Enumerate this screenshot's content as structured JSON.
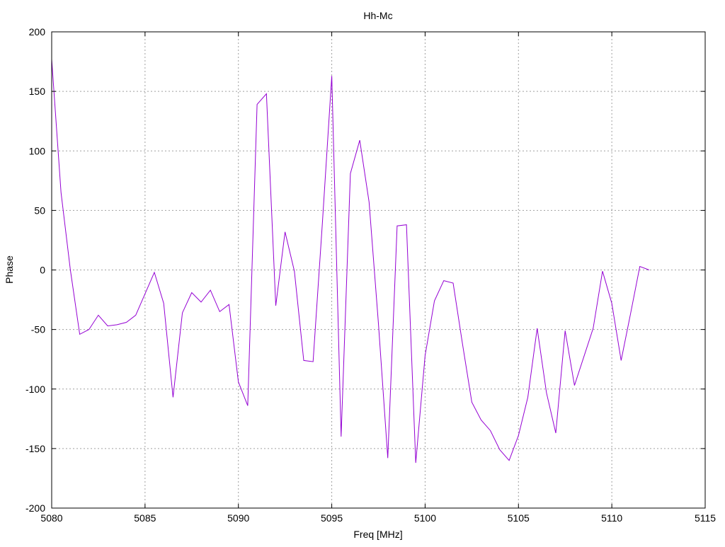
{
  "chart_data": {
    "type": "line",
    "title": "Hh-Mc",
    "xlabel": "Freq [MHz]",
    "ylabel": "Phase",
    "xlim": [
      5080,
      5115
    ],
    "ylim": [
      -200,
      200
    ],
    "xticks": [
      5080,
      5085,
      5090,
      5095,
      5100,
      5105,
      5110,
      5115
    ],
    "yticks": [
      -200,
      -150,
      -100,
      -50,
      0,
      50,
      100,
      150,
      200
    ],
    "grid": true,
    "legend": "none",
    "series": [
      {
        "color": "#9400D3",
        "points": [
          [
            5080.0,
            177
          ],
          [
            5080.5,
            65
          ],
          [
            5081.0,
            0
          ],
          [
            5081.5,
            -54
          ],
          [
            5082.0,
            -50
          ],
          [
            5082.5,
            -38
          ],
          [
            5083.0,
            -47
          ],
          [
            5083.5,
            -46
          ],
          [
            5084.0,
            -44
          ],
          [
            5084.5,
            -38
          ],
          [
            5085.0,
            -20
          ],
          [
            5085.5,
            -2
          ],
          [
            5086.0,
            -28
          ],
          [
            5086.5,
            -107
          ],
          [
            5087.0,
            -36
          ],
          [
            5087.5,
            -19
          ],
          [
            5088.0,
            -27
          ],
          [
            5088.5,
            -17
          ],
          [
            5089.0,
            -35
          ],
          [
            5089.5,
            -29
          ],
          [
            5090.0,
            -94
          ],
          [
            5090.5,
            -114
          ],
          [
            5091.0,
            139
          ],
          [
            5091.5,
            148
          ],
          [
            5092.0,
            -30
          ],
          [
            5092.5,
            32
          ],
          [
            5093.0,
            -1
          ],
          [
            5093.5,
            -76
          ],
          [
            5094.0,
            -77
          ],
          [
            5094.5,
            40
          ],
          [
            5095.0,
            163
          ],
          [
            5095.5,
            -140
          ],
          [
            5096.0,
            81
          ],
          [
            5096.5,
            109
          ],
          [
            5097.0,
            57
          ],
          [
            5097.5,
            -45
          ],
          [
            5098.0,
            -158
          ],
          [
            5098.5,
            37
          ],
          [
            5099.0,
            38
          ],
          [
            5099.5,
            -162
          ],
          [
            5100.0,
            -72
          ],
          [
            5100.5,
            -26
          ],
          [
            5101.0,
            -9
          ],
          [
            5101.5,
            -11
          ],
          [
            5102.0,
            -62
          ],
          [
            5102.5,
            -111
          ],
          [
            5103.0,
            -126
          ],
          [
            5103.5,
            -135
          ],
          [
            5104.0,
            -151
          ],
          [
            5104.5,
            -160
          ],
          [
            5105.0,
            -139
          ],
          [
            5105.5,
            -107
          ],
          [
            5106.0,
            -49
          ],
          [
            5106.5,
            -103
          ],
          [
            5107.0,
            -137
          ],
          [
            5107.5,
            -51
          ],
          [
            5108.0,
            -97
          ],
          [
            5108.5,
            -73
          ],
          [
            5109.0,
            -49
          ],
          [
            5109.5,
            -1
          ],
          [
            5110.0,
            -28
          ],
          [
            5110.5,
            -76
          ],
          [
            5111.0,
            -37
          ],
          [
            5111.5,
            3
          ],
          [
            5112.0,
            0
          ]
        ]
      }
    ]
  }
}
